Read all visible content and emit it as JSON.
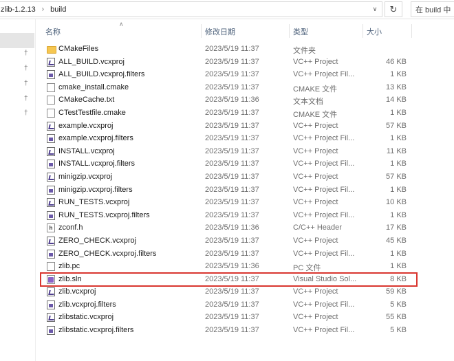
{
  "address": {
    "crumbs": [
      "zlib-1.2.13",
      "build"
    ],
    "search_placeholder": "在 build 中"
  },
  "columns": {
    "name": "名称",
    "date": "修改日期",
    "type": "类型",
    "size": "大小"
  },
  "files": [
    {
      "name": "CMakeFiles",
      "date": "2023/5/19 11:37",
      "type": "文件夹",
      "size": "",
      "icon": "folder-icon"
    },
    {
      "name": "ALL_BUILD.vcxproj",
      "date": "2023/5/19 11:37",
      "type": "VC++ Project",
      "size": "46 KB",
      "icon": "vcxproj-icon"
    },
    {
      "name": "ALL_BUILD.vcxproj.filters",
      "date": "2023/5/19 11:37",
      "type": "VC++ Project Fil...",
      "size": "1 KB",
      "icon": "filters-icon"
    },
    {
      "name": "cmake_install.cmake",
      "date": "2023/5/19 11:37",
      "type": "CMAKE 文件",
      "size": "13 KB",
      "icon": "document-icon"
    },
    {
      "name": "CMakeCache.txt",
      "date": "2023/5/19 11:36",
      "type": "文本文档",
      "size": "14 KB",
      "icon": "document-icon"
    },
    {
      "name": "CTestTestfile.cmake",
      "date": "2023/5/19 11:37",
      "type": "CMAKE 文件",
      "size": "1 KB",
      "icon": "document-icon"
    },
    {
      "name": "example.vcxproj",
      "date": "2023/5/19 11:37",
      "type": "VC++ Project",
      "size": "57 KB",
      "icon": "vcxproj-icon"
    },
    {
      "name": "example.vcxproj.filters",
      "date": "2023/5/19 11:37",
      "type": "VC++ Project Fil...",
      "size": "1 KB",
      "icon": "filters-icon"
    },
    {
      "name": "INSTALL.vcxproj",
      "date": "2023/5/19 11:37",
      "type": "VC++ Project",
      "size": "11 KB",
      "icon": "vcxproj-icon"
    },
    {
      "name": "INSTALL.vcxproj.filters",
      "date": "2023/5/19 11:37",
      "type": "VC++ Project Fil...",
      "size": "1 KB",
      "icon": "filters-icon"
    },
    {
      "name": "minigzip.vcxproj",
      "date": "2023/5/19 11:37",
      "type": "VC++ Project",
      "size": "57 KB",
      "icon": "vcxproj-icon"
    },
    {
      "name": "minigzip.vcxproj.filters",
      "date": "2023/5/19 11:37",
      "type": "VC++ Project Fil...",
      "size": "1 KB",
      "icon": "filters-icon"
    },
    {
      "name": "RUN_TESTS.vcxproj",
      "date": "2023/5/19 11:37",
      "type": "VC++ Project",
      "size": "10 KB",
      "icon": "vcxproj-icon"
    },
    {
      "name": "RUN_TESTS.vcxproj.filters",
      "date": "2023/5/19 11:37",
      "type": "VC++ Project Fil...",
      "size": "1 KB",
      "icon": "filters-icon"
    },
    {
      "name": "zconf.h",
      "date": "2023/5/19 11:36",
      "type": "C/C++ Header",
      "size": "17 KB",
      "icon": "header-file-icon"
    },
    {
      "name": "ZERO_CHECK.vcxproj",
      "date": "2023/5/19 11:37",
      "type": "VC++ Project",
      "size": "45 KB",
      "icon": "vcxproj-icon"
    },
    {
      "name": "ZERO_CHECK.vcxproj.filters",
      "date": "2023/5/19 11:37",
      "type": "VC++ Project Fil...",
      "size": "1 KB",
      "icon": "filters-icon"
    },
    {
      "name": "zlib.pc",
      "date": "2023/5/19 11:36",
      "type": "PC 文件",
      "size": "1 KB",
      "icon": "document-icon"
    },
    {
      "name": "zlib.sln",
      "date": "2023/5/19 11:37",
      "type": "Visual Studio Sol...",
      "size": "8 KB",
      "icon": "solution-icon",
      "highlighted": true
    },
    {
      "name": "zlib.vcxproj",
      "date": "2023/5/19 11:37",
      "type": "VC++ Project",
      "size": "59 KB",
      "icon": "vcxproj-icon"
    },
    {
      "name": "zlib.vcxproj.filters",
      "date": "2023/5/19 11:37",
      "type": "VC++ Project Fil...",
      "size": "5 KB",
      "icon": "filters-icon"
    },
    {
      "name": "zlibstatic.vcxproj",
      "date": "2023/5/19 11:37",
      "type": "VC++ Project",
      "size": "55 KB",
      "icon": "vcxproj-icon"
    },
    {
      "name": "zlibstatic.vcxproj.filters",
      "date": "2023/5/19 11:37",
      "type": "VC++ Project Fil...",
      "size": "5 KB",
      "icon": "filters-icon"
    }
  ],
  "colors": {
    "highlight_border": "#d9362f",
    "header_text": "#4c607a",
    "folder": "#f6c751"
  }
}
